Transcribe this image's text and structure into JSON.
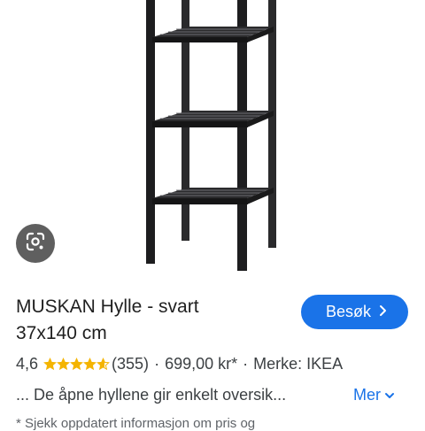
{
  "product": {
    "title_line1": "MUSKAN Hylle - svart",
    "title_line2": "37x140 cm",
    "rating": "4,6",
    "stars": 4.6,
    "reviews": "(355)",
    "price": "699,00 kr*",
    "brand": "Merke: IKEA",
    "description": "... De åpne hyllene gir enkelt oversik...",
    "more_label": "Mer",
    "footnote": "* Sjekk oppdatert informasjon om pris og"
  },
  "actions": {
    "visit_label": "Besøk"
  },
  "icons": {
    "lens": "google-lens-icon",
    "visit": "chevron-right-icon",
    "more": "chevron-down-icon",
    "star": "star-icon"
  },
  "colors": {
    "accent": "#1a73e8",
    "star": "#f4b400",
    "shelf": "#1d1d1f",
    "lens_bg": "#5f5f5f"
  }
}
